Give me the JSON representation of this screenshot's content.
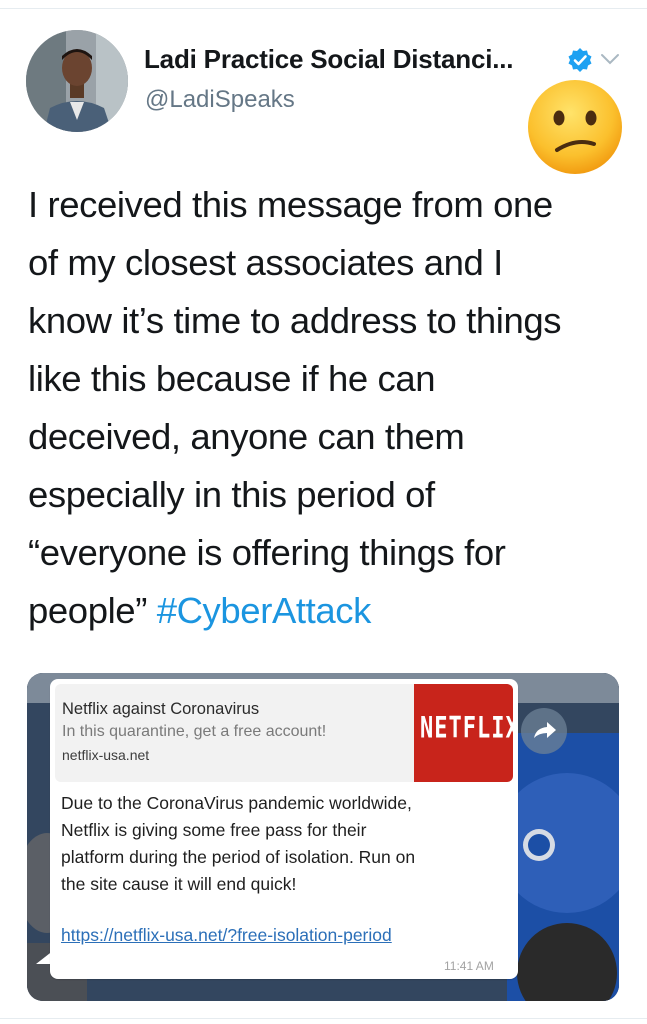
{
  "tweet": {
    "display_name": "Ladi Practice Social Distanci...",
    "handle": "@LadiSpeaks",
    "text_lines": [
      "I received this message from one",
      "of my closest associates and I",
      "know it’s time to address to things",
      "like this because if he can",
      "deceived, anyone can them",
      "especially in this period of",
      "“everyone is offering things for"
    ],
    "last_line_text": "people” ",
    "hashtag": "#CyberAttack",
    "icons": [
      "verified-badge-icon",
      "chevron-down-icon",
      "confused-face-emoji"
    ],
    "colors": {
      "hashtag": "#1b95e0",
      "verified": "#1da1f2",
      "handle": "#657786"
    }
  },
  "media": {
    "link_preview": {
      "title": "Netflix against Coronavirus",
      "description": "In this quarantine, get a free account!",
      "domain": "netflix-usa.net",
      "thumbnail_text": "NETFLIX"
    },
    "message_lines": [
      "Due to the CoronaVirus pandemic worldwide,",
      "Netflix is giving some free pass for their",
      "platform during the period of isolation. Run on",
      "the site cause it will end quick!"
    ],
    "link": "https://netflix-usa.net/?free-isolation-period",
    "time": "11:41 AM",
    "forward_icon": "forward-arrow-icon",
    "colors": {
      "netflix_red": "#c8241b",
      "link": "#2b6fb8"
    }
  }
}
